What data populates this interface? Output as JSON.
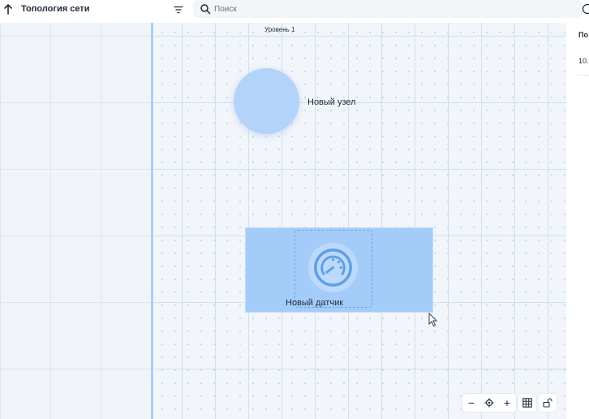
{
  "header": {
    "title": "Топология сети",
    "back_icon": "arrow-up-icon",
    "filter_icon": "filter-icon",
    "help_icon": "help-circle-icon"
  },
  "search": {
    "placeholder": "Поиск",
    "value": ""
  },
  "canvas": {
    "level_label": "Уровень 1",
    "nodes": [
      {
        "type": "node",
        "label": "Новый узел",
        "color": "#b3d3fb"
      },
      {
        "type": "sensor",
        "label": "Новый датчик",
        "icon": "gauge-icon",
        "selected": true
      }
    ],
    "selection_color": "#a3cdf8"
  },
  "controls": {
    "zoom_out": "−",
    "zoom_in": "+",
    "center_icon": "target-icon",
    "grid_icon": "grid-icon",
    "lock_icon": "unlock-icon"
  },
  "right_panel": {
    "title": "По",
    "value": "10."
  },
  "colors": {
    "accent": "#a9d0f5",
    "canvas_bg": "#f1f4f8"
  }
}
